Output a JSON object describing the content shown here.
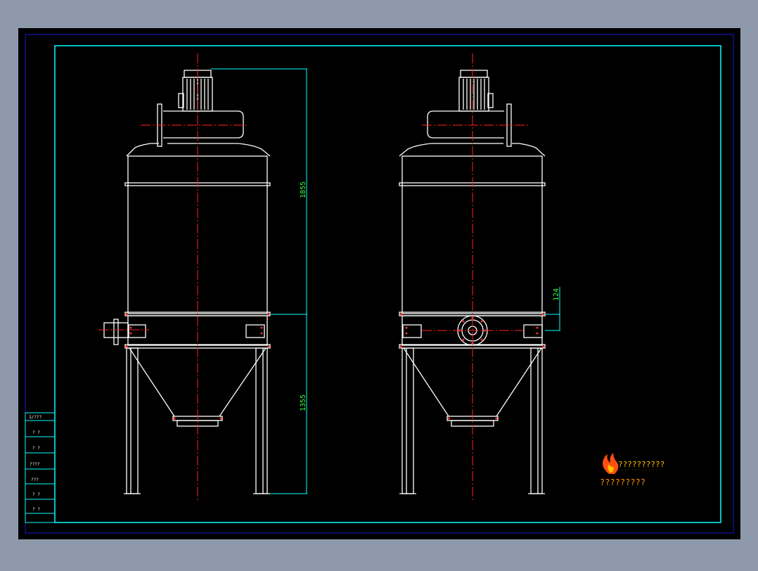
{
  "drawing": {
    "dimension_height_upper": "1855",
    "dimension_height_lower": "1355",
    "dimension_flange_offset": "124"
  },
  "title_block": {
    "rows": [
      "1/???",
      "? ?",
      "? ?",
      "????",
      "???",
      "? ?",
      "? ?"
    ]
  },
  "logo": {
    "line1": "??????????",
    "line2": "· · · · · · · · · · · ·",
    "line3": "?????????"
  },
  "colors": {
    "background": "#8e9aab",
    "sheet": "#000000",
    "border_outer": "#1a1ad0",
    "frame": "#00ffff",
    "outline": "#ffffff",
    "centerline": "#ff2020",
    "dimension_text": "#33ff33",
    "title_text": "#ffffff",
    "logo_text": "#ffc000"
  }
}
